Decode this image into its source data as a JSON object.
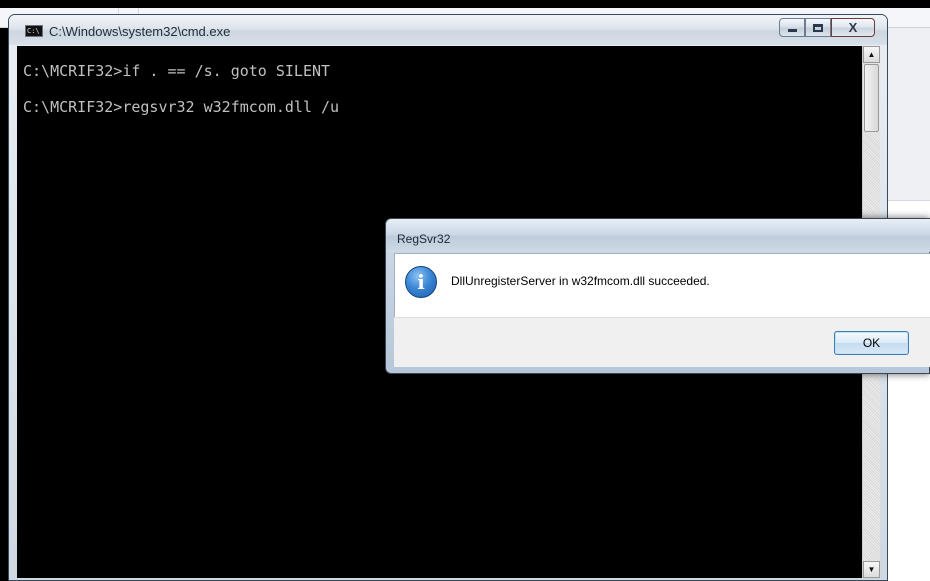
{
  "cmd_window": {
    "title": "C:\\Windows\\system32\\cmd.exe",
    "icon": "console-icon",
    "icon_text": "C:\\",
    "buttons": {
      "minimize": "minimize-icon",
      "maximize": "maximize-icon",
      "close_label": "X"
    },
    "lines": [
      "C:\\MCRIF32>if . == /s. goto SILENT",
      "C:\\MCRIF32>regsvr32 w32fmcom.dll /u"
    ],
    "scroll": {
      "up": "▲",
      "down": "▼"
    }
  },
  "dialog": {
    "title": "RegSvr32",
    "icon": "information-icon",
    "icon_glyph": "i",
    "message": "DllUnregisterServer in w32fmcom.dll succeeded.",
    "ok_label": "OK"
  },
  "colors": {
    "console_bg": "#000000",
    "console_text": "#c0c0c0",
    "dialog_button_border": "#3c7fb1"
  }
}
